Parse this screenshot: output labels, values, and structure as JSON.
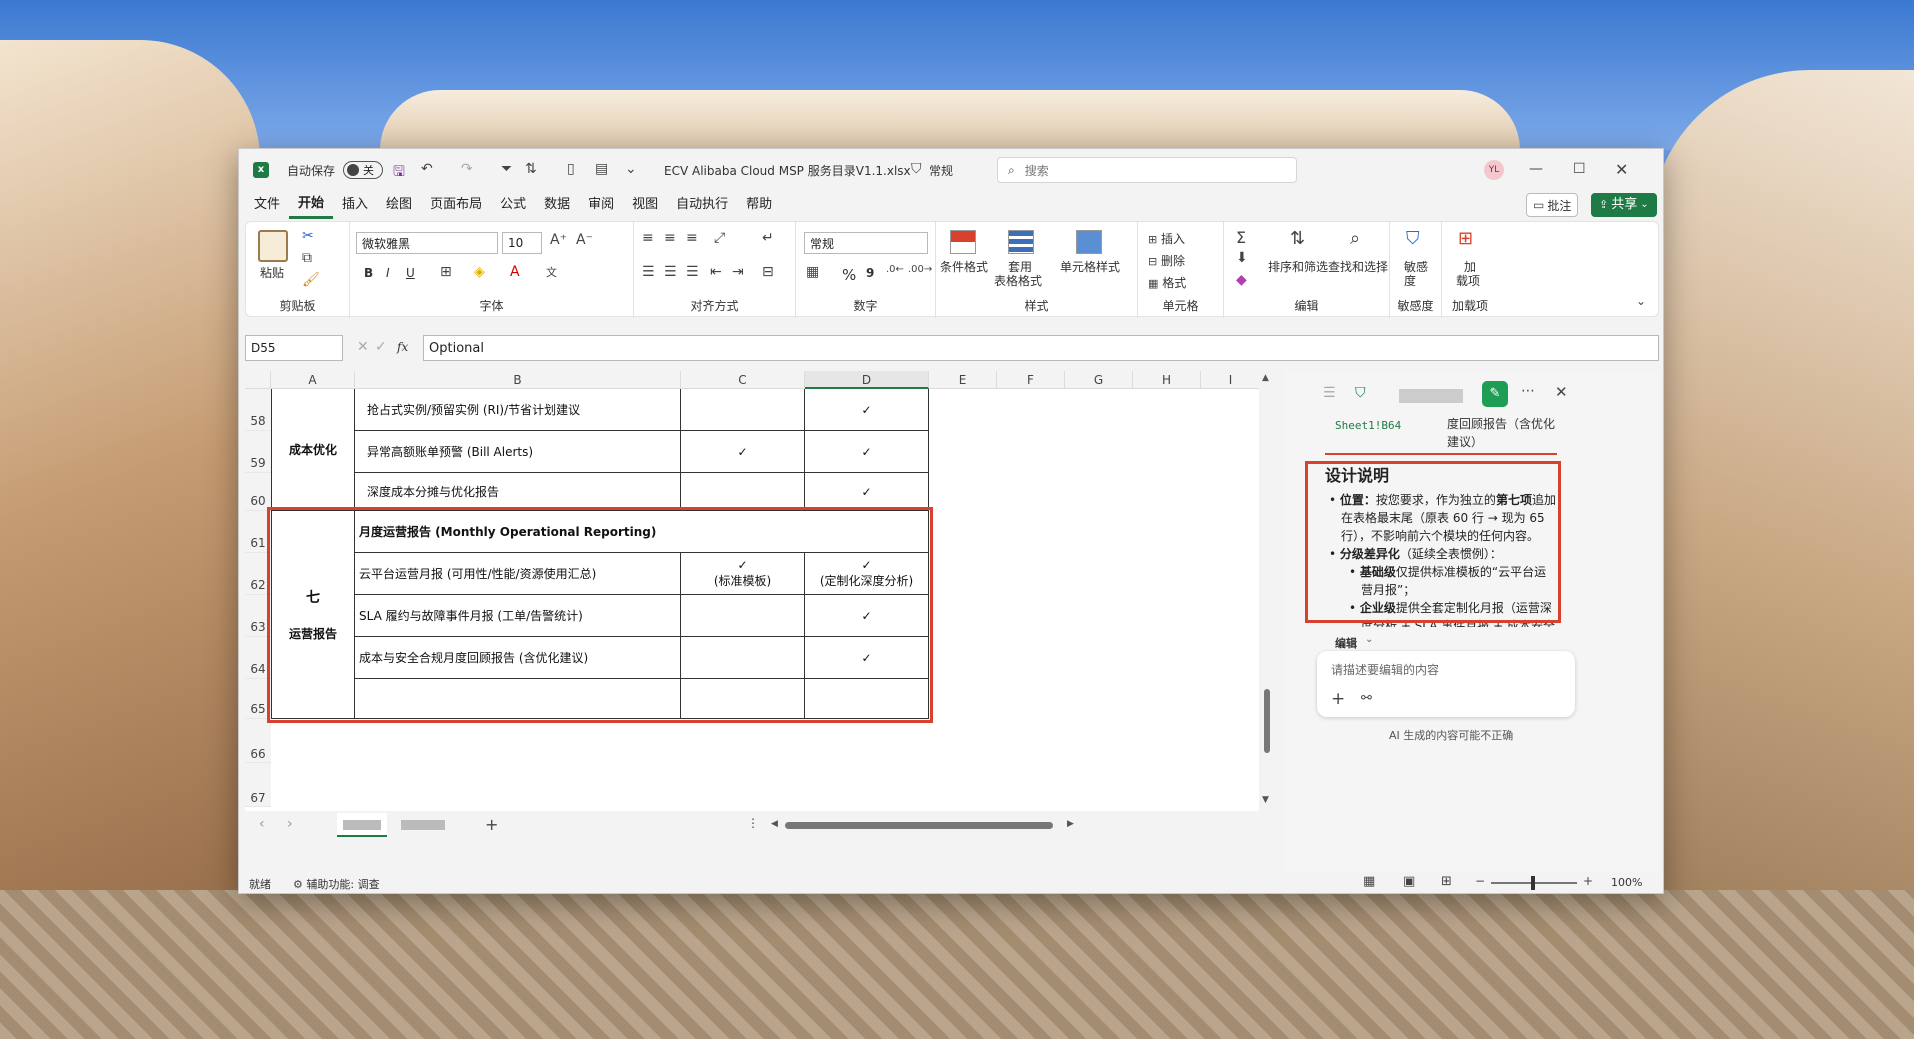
{
  "window": {
    "autosave_label": "自动保存",
    "autosave_state": "关",
    "filename": "ECV Alibaba Cloud MSP 服务目录V1.1.xlsx",
    "sensitivity": "常规",
    "search_placeholder": "搜索",
    "user_initials": "YL"
  },
  "menus": [
    "文件",
    "开始",
    "插入",
    "绘图",
    "页面布局",
    "公式",
    "数据",
    "审阅",
    "视图",
    "自动执行",
    "帮助"
  ],
  "ribbon": {
    "comment_btn": "批注",
    "share_btn": "共享",
    "clipboard": {
      "paste": "粘贴",
      "label": "剪贴板"
    },
    "font": {
      "name": "微软雅黑",
      "size": "10",
      "bold": "B",
      "italic": "I",
      "underline": "U",
      "label": "字体"
    },
    "align": {
      "label": "对齐方式"
    },
    "number": {
      "format": "常规",
      "percent": "%",
      "comma": "9",
      "label": "数字"
    },
    "styles": {
      "cond": "条件格式",
      "table1": "套用",
      "table2": "表格格式",
      "cell": "单元格样式",
      "label": "样式"
    },
    "cells": {
      "insert": "插入",
      "delete": "删除",
      "format": "格式",
      "label": "单元格"
    },
    "edit": {
      "sort": "排序和筛选",
      "find": "查找和选择",
      "label": "编辑"
    },
    "sens": {
      "btn1": "敏感",
      "btn2": "度",
      "label": "敏感度"
    },
    "addin": {
      "btn1": "加",
      "btn2": "载项",
      "label": "加载项"
    }
  },
  "formula": {
    "namebox": "D55",
    "fx": "fx",
    "value": "Optional"
  },
  "columns": [
    "A",
    "B",
    "C",
    "D",
    "E",
    "F",
    "G",
    "H",
    "I"
  ],
  "rows": [
    "58",
    "59",
    "60",
    "61",
    "62",
    "63",
    "64",
    "65",
    "66",
    "67"
  ],
  "cells": {
    "r58b": "抢占式实例/预留实例 (RI)/节省计划建议",
    "r58d": "✓",
    "r59b": "异常高额账单预警 (Bill Alerts)",
    "r59c": "✓",
    "r59d": "✓",
    "r60b": "深度成本分摊与优化报告",
    "r60d": "✓",
    "group1": "成本优化",
    "r61b": "月度运营报告 (Monthly Operational Reporting)",
    "r62b": "云平台运营月报 (可用性/性能/资源使用汇总)",
    "r62c1": "✓",
    "r62c2": "(标准模板)",
    "r62d1": "✓",
    "r62d2": "(定制化深度分析)",
    "r63b": "SLA 履约与故障事件月报 (工单/告警统计)",
    "r63d": "✓",
    "r64b": "成本与安全合规月度回顾报告 (含优化建议)",
    "r64d": "✓",
    "group2a": "七",
    "group2b": "运营报告"
  },
  "pane": {
    "ref": "Sheet1!B64",
    "ref_text": "度回顾报告（含优化建议）",
    "title": "设计说明",
    "b1_label": "位置：",
    "b1_text": "按您要求，作为独立的",
    "b1_bold": "第七项",
    "b1_rest": "追加在表格最末尾（原表 60 行 → 现为 65 行），不影响前六个模块的任何内容。",
    "b2_label": "分级差异化",
    "b2_text": "（延续全表惯例）：",
    "s1_label": "基础级",
    "s1_text": "仅提供标准模板的“云平台运营月报”；",
    "s2_label": "企业级",
    "s2_text": "提供全套定制化月报（运营深度分析 + SLA 事件月报 + 成本安全合",
    "edit_label": "编辑",
    "input_placeholder": "请描述要编辑的内容",
    "disclaimer": "AI 生成的内容可能不正确"
  },
  "status": {
    "ready": "就绪",
    "access": "辅助功能: 调查",
    "zoom": "100%"
  }
}
